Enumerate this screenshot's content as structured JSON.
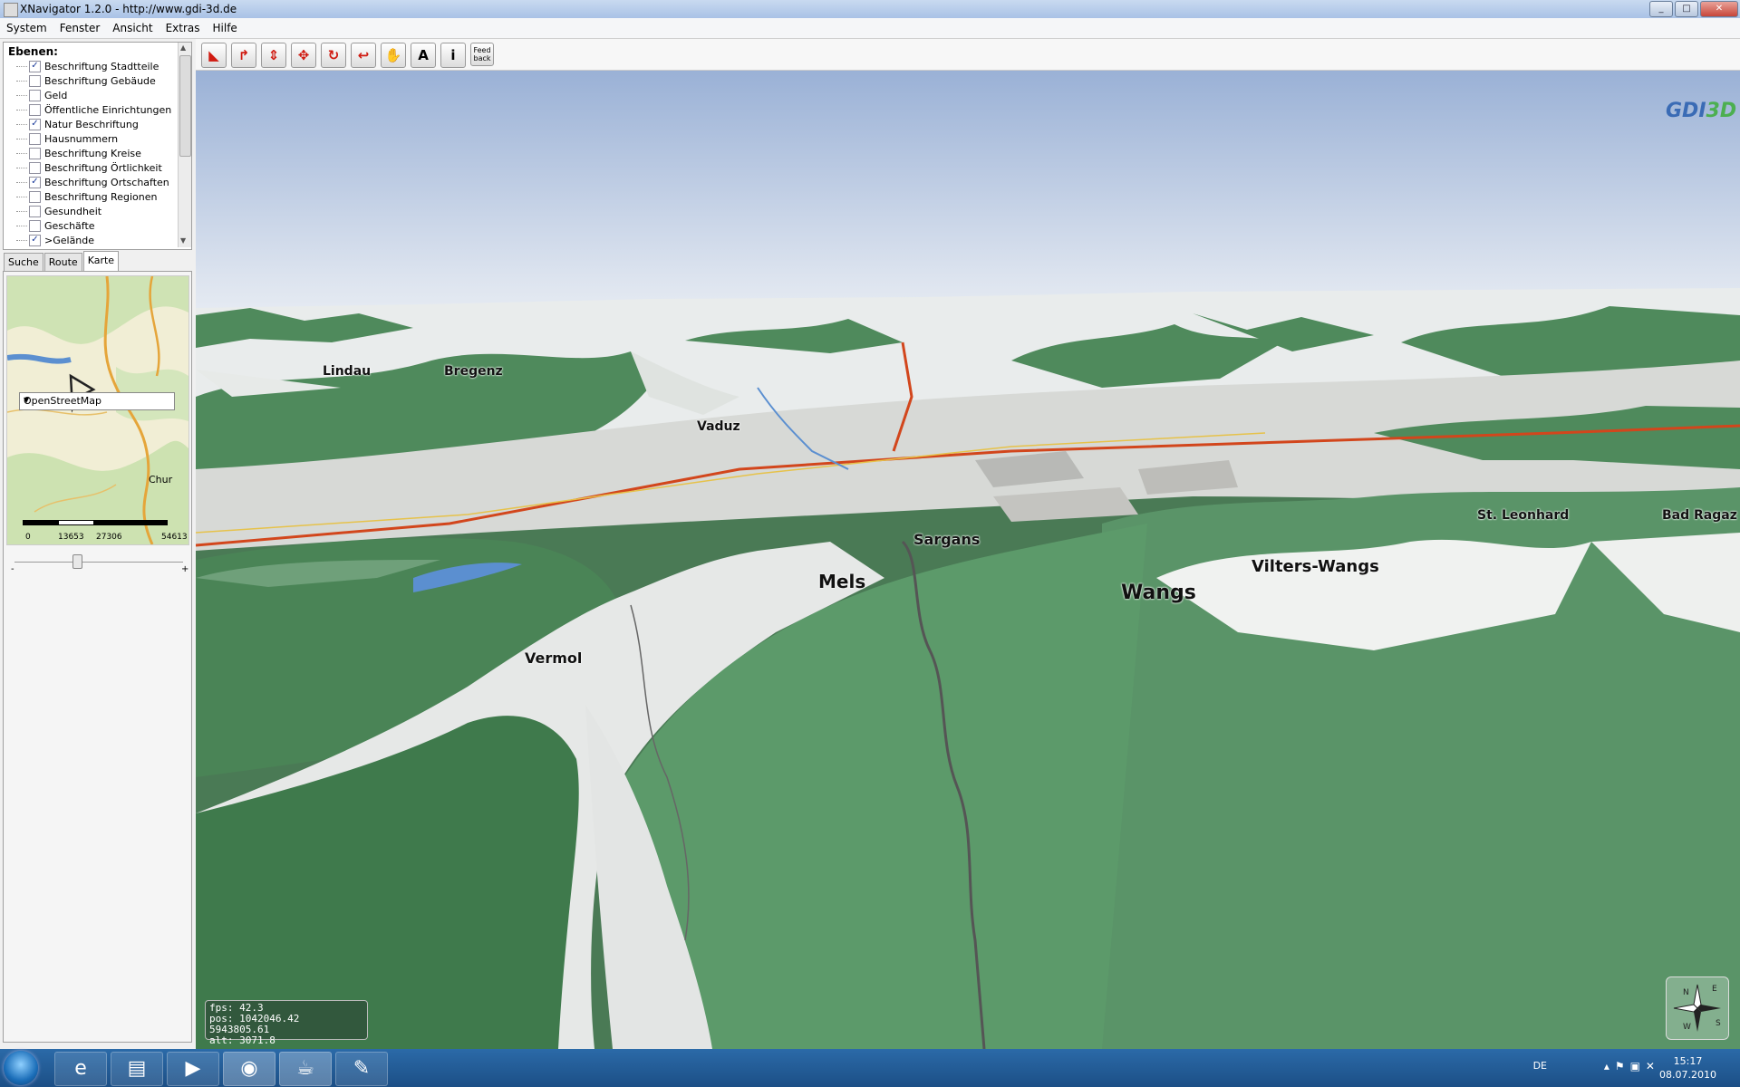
{
  "window": {
    "title": "XNavigator 1.2.0 - http://www.gdi-3d.de"
  },
  "menu": [
    "System",
    "Fenster",
    "Ansicht",
    "Extras",
    "Hilfe"
  ],
  "layers": {
    "heading": "Ebenen:",
    "items": [
      {
        "label": "Beschriftung Stadtteile",
        "checked": true
      },
      {
        "label": "Beschriftung Gebäude",
        "checked": false
      },
      {
        "label": "Geld",
        "checked": false
      },
      {
        "label": "Öffentliche Einrichtungen",
        "checked": false
      },
      {
        "label": "Natur Beschriftung",
        "checked": true
      },
      {
        "label": "Hausnummern",
        "checked": false
      },
      {
        "label": "Beschriftung Kreise",
        "checked": false
      },
      {
        "label": "Beschriftung Örtlichkeit",
        "checked": false
      },
      {
        "label": "Beschriftung Ortschaften",
        "checked": true
      },
      {
        "label": "Beschriftung Regionen",
        "checked": false
      },
      {
        "label": "Gesundheit",
        "checked": false
      },
      {
        "label": "Geschäfte",
        "checked": false
      },
      {
        "label": ">Gelände",
        "checked": true
      }
    ]
  },
  "tabs": [
    "Suche",
    "Route",
    "Karte"
  ],
  "active_tab": "Karte",
  "minimap": {
    "city_label": "Chur",
    "scale": [
      "0",
      "13653",
      "27306",
      "54613"
    ],
    "zoom_minus": "-",
    "zoom_plus": "+",
    "map_source": "OpenStreetMap"
  },
  "toolbar": {
    "feedback_label": "Feed back",
    "text_tool": "A",
    "info_tool": "i"
  },
  "viewport": {
    "logo_a": "GDI",
    "logo_b": "3D",
    "places": [
      "Lindau",
      "Bregenz",
      "Vaduz",
      "Sargans",
      "Mels",
      "Wangs",
      "Vilters-Wangs",
      "St. Leonhard",
      "Bad Ragaz",
      "Vermol"
    ],
    "stats": {
      "fps": "fps: 42.3",
      "pos": "pos: 1042046.42  5943805.61",
      "alt": "alt: 3071.8"
    },
    "compass": [
      "N",
      "E",
      "S",
      "W"
    ]
  },
  "taskbar": {
    "lang": "DE",
    "time": "15:17",
    "date": "08.07.2010"
  },
  "colors": {
    "forest": "#4f8a5c",
    "snow": "#f2f4f2",
    "sky_top": "#9ab1d6",
    "road": "#d2461c"
  }
}
